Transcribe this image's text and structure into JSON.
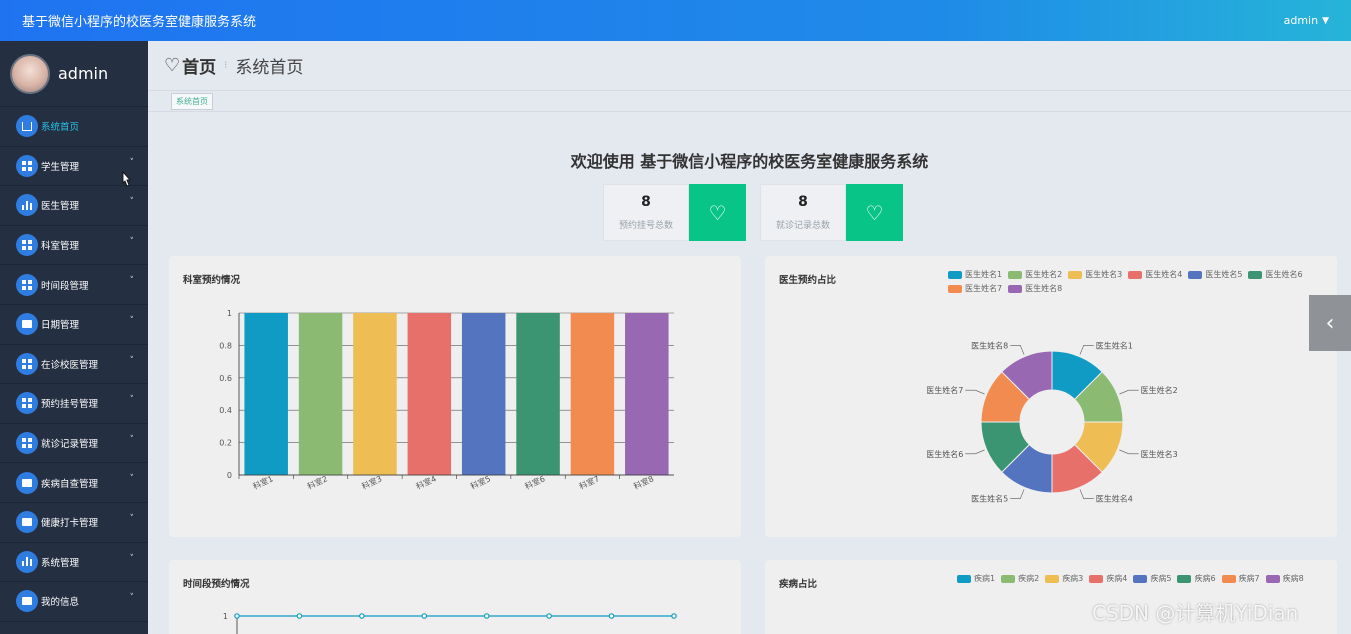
{
  "topbar": {
    "title": "基于微信小程序的校医务室健康服务系统",
    "user": "admin"
  },
  "sidebar": {
    "username": "admin",
    "items": [
      {
        "label": "系统首页",
        "icon": "home-icon",
        "active": true
      },
      {
        "label": "学生管理",
        "icon": "grid-icon"
      },
      {
        "label": "医生管理",
        "icon": "chart-icon"
      },
      {
        "label": "科室管理",
        "icon": "grid-icon"
      },
      {
        "label": "时间段管理",
        "icon": "grid-icon"
      },
      {
        "label": "日期管理",
        "icon": "monitor-icon"
      },
      {
        "label": "在诊校医管理",
        "icon": "grid-icon"
      },
      {
        "label": "预约挂号管理",
        "icon": "grid-icon"
      },
      {
        "label": "就诊记录管理",
        "icon": "grid-icon"
      },
      {
        "label": "疾病自查管理",
        "icon": "document-icon"
      },
      {
        "label": "健康打卡管理",
        "icon": "monitor-icon"
      },
      {
        "label": "系统管理",
        "icon": "bar-chart-icon"
      },
      {
        "label": "我的信息",
        "icon": "window-icon"
      }
    ]
  },
  "breadcrumb": {
    "main": "首页",
    "sub": "系统首页",
    "tag": "系统首页"
  },
  "welcome": "欢迎使用 基于微信小程序的校医务室健康服务系统",
  "stats": [
    {
      "value": "8",
      "label": "预约挂号总数"
    },
    {
      "value": "8",
      "label": "就诊记录总数"
    }
  ],
  "colors": [
    "#0f9bc3",
    "#8bbb72",
    "#eebd54",
    "#e8706a",
    "#5474c0",
    "#3b9472",
    "#f28b4f",
    "#9868b3"
  ],
  "chart_data": [
    {
      "type": "bar",
      "title": "科室预约情况",
      "categories": [
        "科室1",
        "科室2",
        "科室3",
        "科室4",
        "科室5",
        "科室6",
        "科室7",
        "科室8"
      ],
      "values": [
        1,
        1,
        1,
        1,
        1,
        1,
        1,
        1
      ],
      "ylim": [
        0,
        1
      ],
      "yticks": [
        "0",
        "0.2",
        "0.4",
        "0.6",
        "0.8",
        "1"
      ]
    },
    {
      "type": "pie",
      "title": "医生预约占比",
      "categories": [
        "医生姓名1",
        "医生姓名2",
        "医生姓名3",
        "医生姓名4",
        "医生姓名5",
        "医生姓名6",
        "医生姓名7",
        "医生姓名8"
      ],
      "values": [
        1,
        1,
        1,
        1,
        1,
        1,
        1,
        1
      ],
      "legend": "top-right"
    },
    {
      "type": "line",
      "title": "时间段预约情况",
      "values": [
        1,
        1,
        1,
        1,
        1,
        1,
        1,
        1
      ],
      "yticks": [
        "1"
      ]
    },
    {
      "type": "pie",
      "title": "疾病占比",
      "categories": [
        "疾病1",
        "疾病2",
        "疾病3",
        "疾病4",
        "疾病5",
        "疾病6",
        "疾病7",
        "疾病8"
      ],
      "legend": "top-right"
    }
  ],
  "watermark": "CSDN @计算机YiDian"
}
